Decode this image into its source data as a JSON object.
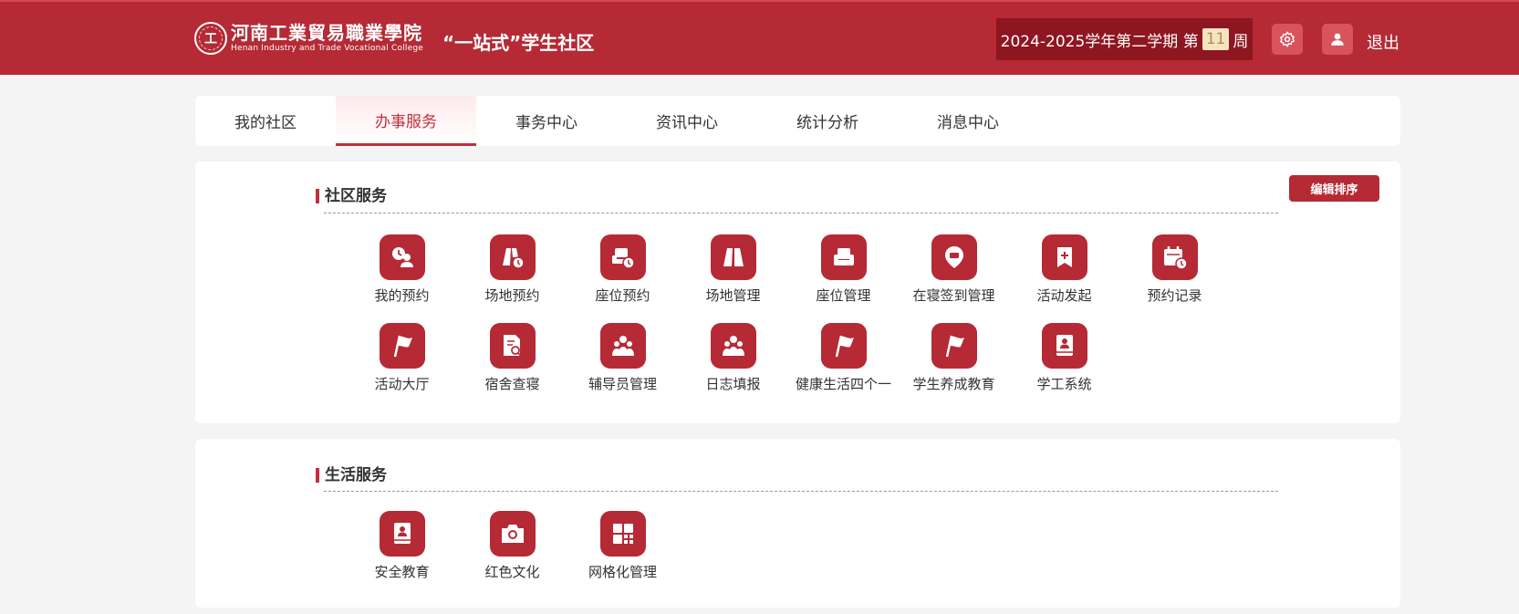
{
  "header": {
    "logo_mark": "工",
    "school_name_cn": "河南工業貿易職業學院",
    "school_name_en": "Henan Industry and Trade Vocational College",
    "site_title": "“一站式”学生社区",
    "term_label": "2024-2025学年第二学期 第",
    "week_number": "11",
    "week_suffix": "周",
    "settings_icon": "gear-icon",
    "user_icon": "user-icon",
    "logout_label": "退出"
  },
  "nav": {
    "tabs": [
      {
        "label": "我的社区",
        "active": false
      },
      {
        "label": "办事服务",
        "active": true
      },
      {
        "label": "事务中心",
        "active": false
      },
      {
        "label": "资讯中心",
        "active": false
      },
      {
        "label": "统计分析",
        "active": false
      },
      {
        "label": "消息中心",
        "active": false
      }
    ]
  },
  "community": {
    "title": "社区服务",
    "edit_label": "编辑排序",
    "items": [
      {
        "label": "我的预约",
        "icon": "my-booking-icon"
      },
      {
        "label": "场地预约",
        "icon": "venue-booking-icon"
      },
      {
        "label": "座位预约",
        "icon": "seat-booking-icon"
      },
      {
        "label": "场地管理",
        "icon": "venue-manage-icon"
      },
      {
        "label": "座位管理",
        "icon": "seat-manage-icon"
      },
      {
        "label": "在寝签到管理",
        "icon": "location-pin-icon"
      },
      {
        "label": "活动发起",
        "icon": "bookmark-plus-icon"
      },
      {
        "label": "预约记录",
        "icon": "calendar-clock-icon"
      },
      {
        "label": "活动大厅",
        "icon": "flag-icon"
      },
      {
        "label": "宿舍查寝",
        "icon": "document-search-icon"
      },
      {
        "label": "辅导员管理",
        "icon": "group-icon"
      },
      {
        "label": "日志填报",
        "icon": "group-icon"
      },
      {
        "label": "健康生活四个一",
        "icon": "flag-icon"
      },
      {
        "label": "学生养成教育",
        "icon": "flag-icon"
      },
      {
        "label": "学工系统",
        "icon": "contact-book-icon"
      }
    ]
  },
  "life": {
    "title": "生活服务",
    "items": [
      {
        "label": "安全教育",
        "icon": "contact-book-icon"
      },
      {
        "label": "红色文化",
        "icon": "camera-icon"
      },
      {
        "label": "网格化管理",
        "icon": "grid-icon"
      }
    ]
  },
  "colors": {
    "brand": "#b52a35",
    "brand_dark": "#8e1620",
    "accent_text": "#c0303c"
  }
}
